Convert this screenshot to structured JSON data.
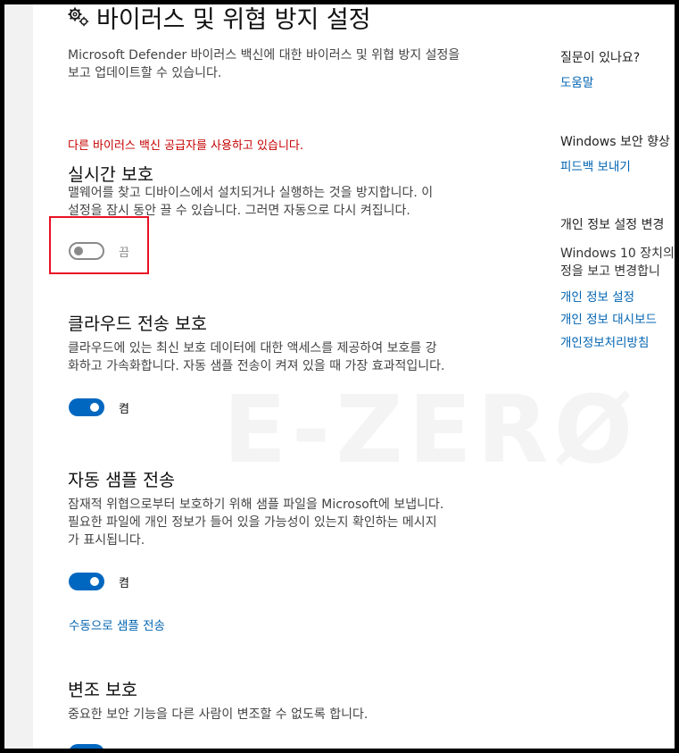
{
  "page": {
    "title": "바이러스 및 위협 방지 설정",
    "description_line1": "Microsoft Defender 바이러스 백신에 대한 바이러스 및 위협 방지 설정을",
    "description_line2": "보고 업데이트할 수 있습니다.",
    "warning": "다른 바이러스 백신 공급자를 사용하고 있습니다."
  },
  "realtime": {
    "title": "실시간 보호",
    "desc_line1": "맬웨어를 찾고 디바이스에서 설치되거나 실행하는 것을 방지합니다. 이",
    "desc_line2": "설정을 잠시 동안 끌 수 있습니다. 그러면 자동으로 다시 켜집니다.",
    "toggle_label": "끔",
    "enabled": false
  },
  "cloud": {
    "title": "클라우드 전송 보호",
    "desc_line1": "클라우드에 있는 최신 보호 데이터에 대한 액세스를 제공하여 보호를 강",
    "desc_line2": "화하고 가속화합니다. 자동 샘플 전송이 켜져 있을 때 가장 효과적입니다.",
    "toggle_label": "켬",
    "enabled": true
  },
  "sample": {
    "title": "자동 샘플 전송",
    "desc_line1": "잠재적 위협으로부터 보호하기 위해 샘플 파일을 Microsoft에 보냅니다.",
    "desc_line2": "필요한 파일에 개인 정보가 들어 있을 가능성이 있는지 확인하는 메시지",
    "desc_line3": "가 표시됩니다.",
    "toggle_label": "켬",
    "enabled": true,
    "manual_link": "수동으로 샘플 전송"
  },
  "tamper": {
    "title": "변조 보호",
    "desc_line1": "중요한 보안 기능을 다른 사람이 변조할 수 없도록 합니다."
  },
  "sidebar": {
    "question_head": "질문이 있나요?",
    "help_link": "도움말",
    "improve_head": "Windows 보안 향상",
    "feedback_link": "피드백 보내기",
    "privacy_head": "개인 정보 설정 변경",
    "privacy_text_line1": "Windows 10 장치의",
    "privacy_text_line2": "정을 보고 변경합니",
    "privacy_settings_link": "개인 정보 설정",
    "privacy_dashboard_link": "개인 정보 대시보드",
    "privacy_statement_link": "개인정보처리방침"
  },
  "watermark": "E-ZERØ",
  "colors": {
    "accent": "#0067c0",
    "link": "#0063b1",
    "warning": "#c50000",
    "highlight": "#e81123"
  }
}
